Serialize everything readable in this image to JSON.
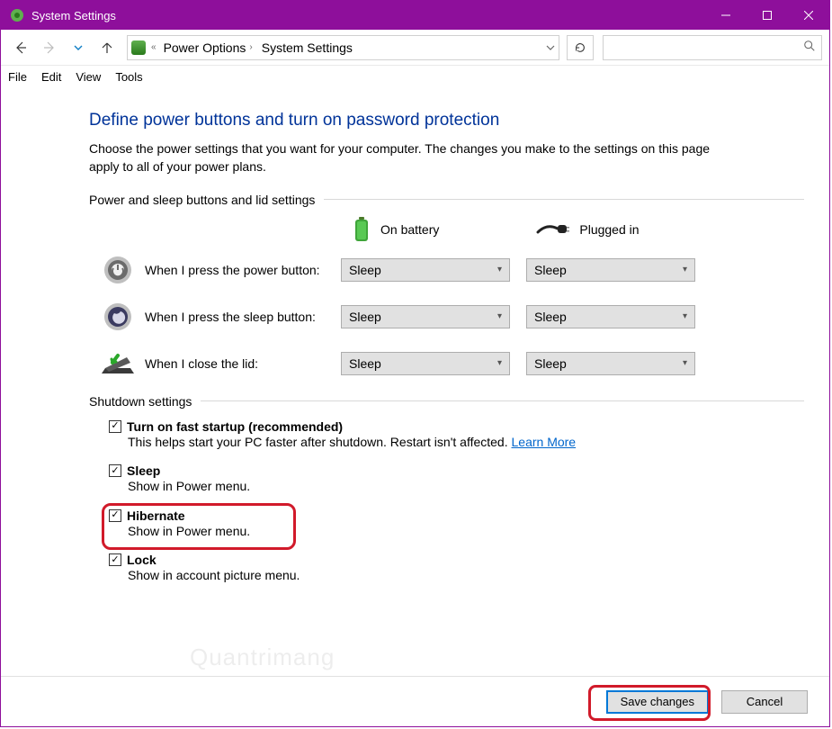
{
  "window": {
    "title": "System Settings"
  },
  "menubar": {
    "file": "File",
    "edit": "Edit",
    "view": "View",
    "tools": "Tools"
  },
  "breadcrumb": {
    "parent": "Power Options",
    "current": "System Settings"
  },
  "page": {
    "heading": "Define power buttons and turn on password protection",
    "description": "Choose the power settings that you want for your computer. The changes you make to the settings on this page apply to all of your power plans.",
    "group1_title": "Power and sleep buttons and lid settings",
    "col_battery": "On battery",
    "col_plugged": "Plugged in",
    "rows": [
      {
        "label": "When I press the power button:",
        "battery": "Sleep",
        "plugged": "Sleep"
      },
      {
        "label": "When I press the sleep button:",
        "battery": "Sleep",
        "plugged": "Sleep"
      },
      {
        "label": "When I close the lid:",
        "battery": "Sleep",
        "plugged": "Sleep"
      }
    ],
    "group2_title": "Shutdown settings",
    "shutdown": {
      "fast": {
        "title": "Turn on fast startup (recommended)",
        "sub_a": "This helps start your PC faster after shutdown. Restart isn't affected. ",
        "learn": "Learn More"
      },
      "sleep": {
        "title": "Sleep",
        "sub": "Show in Power menu."
      },
      "hibernate": {
        "title": "Hibernate",
        "sub": "Show in Power menu."
      },
      "lock": {
        "title": "Lock",
        "sub": "Show in account picture menu."
      }
    }
  },
  "footer": {
    "save": "Save changes",
    "cancel": "Cancel"
  },
  "watermark": "Quantrimang"
}
